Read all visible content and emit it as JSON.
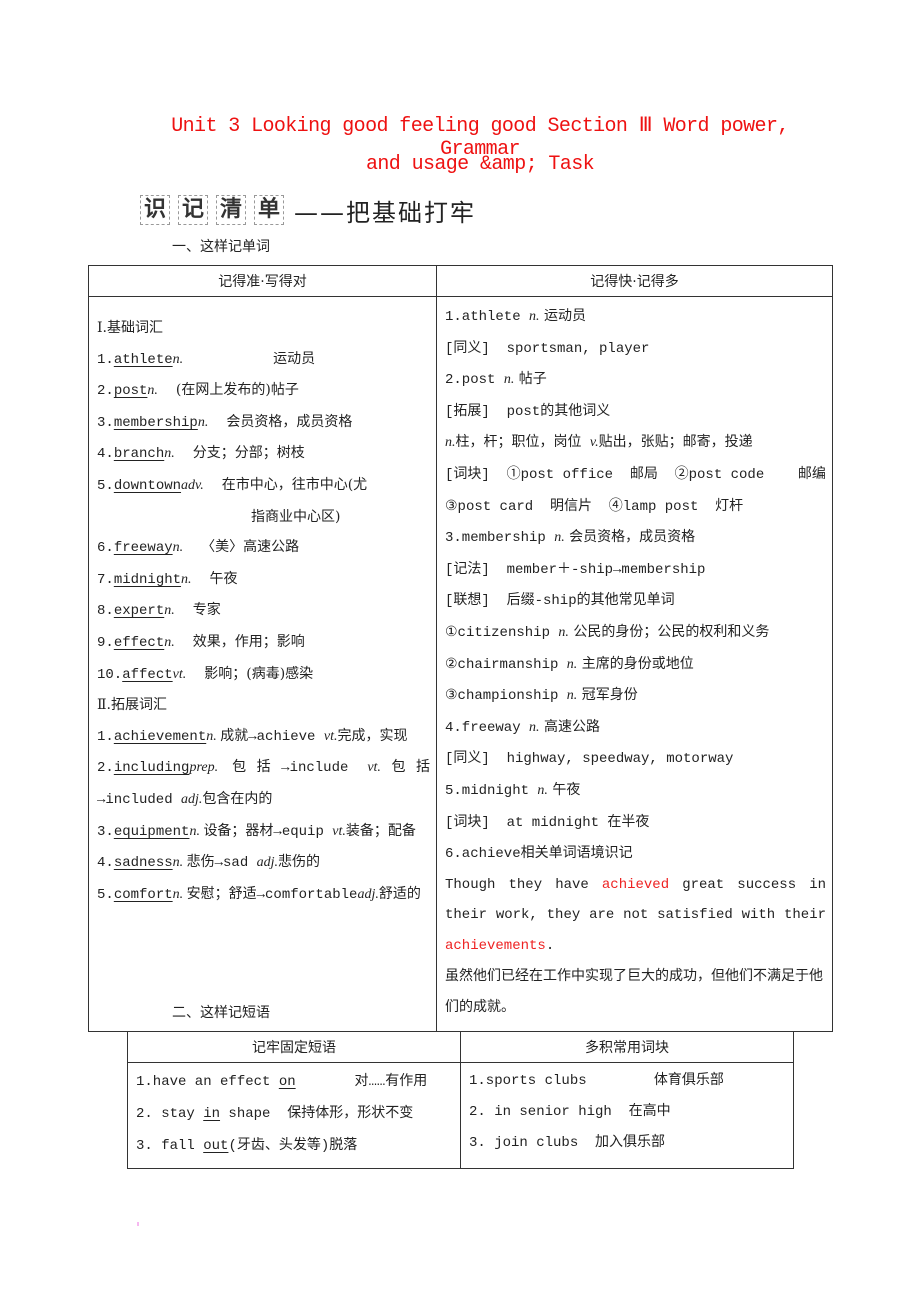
{
  "title": {
    "line1": "Unit 3 Looking good feeling good Section Ⅲ Word power, Grammar",
    "line2": "and usage &amp; Task",
    "color": "#ee1111"
  },
  "banner": {
    "boxed_chars": [
      "识",
      "记",
      "清",
      "单"
    ],
    "rest": "——把基础打牢"
  },
  "section1": {
    "heading": "一、这样记单词",
    "table": {
      "headers": [
        "记得准·写得对",
        "记得快·记得多"
      ],
      "left": {
        "basic_heading": "Ⅰ.基础词汇",
        "basic": [
          {
            "num": "1.",
            "word": "athlete",
            "pos": "n.",
            "meaning": "运动员"
          },
          {
            "num": "2.",
            "word": "post",
            "pos": "n.",
            "meaning": "(在网上发布的)帖子"
          },
          {
            "num": "3.",
            "word": "membership",
            "pos": "n.",
            "meaning": "会员资格，成员资格"
          },
          {
            "num": "4.",
            "word": "branch",
            "pos": "n.",
            "meaning": "分支；分部；树枝"
          },
          {
            "num": "5.",
            "word": "downtown",
            "pos": "adv.",
            "meaning": "在市中心，往市中心(尤",
            "meaning_cont": "指商业中心区)"
          },
          {
            "num": "6.",
            "word": "freeway",
            "pos": "n.",
            "meaning": "〈美〉高速公路"
          },
          {
            "num": "7.",
            "word": "midnight",
            "pos": "n.",
            "meaning": "午夜"
          },
          {
            "num": "8.",
            "word": "expert",
            "pos": "n.",
            "meaning": "专家"
          },
          {
            "num": "9.",
            "word": "effect",
            "pos": "n.",
            "meaning": "效果，作用；影响"
          },
          {
            "num": "10.",
            "word": "affect",
            "pos": "vt.",
            "meaning": "影响；(病毒)感染"
          }
        ],
        "extended_heading": "Ⅱ.拓展词汇",
        "extended": [
          {
            "num": "1.",
            "word": "achievement",
            "pos": "n.",
            "rest": "成就→achieve ",
            "pos2": "vt.",
            "rest2": "完成，实现"
          },
          {
            "num": "2.",
            "word": "including",
            "pos": "prep.",
            "rest": "包括→include ",
            "pos2": "vt.",
            "rest2": "包括→included ",
            "pos3": "adj.",
            "rest3": "包含在内的"
          },
          {
            "num": "3.",
            "word": "equipment",
            "pos": "n.",
            "rest": "设备；器材→equip ",
            "pos2": "vt.",
            "rest2": "装备；配备"
          },
          {
            "num": "4.",
            "word": "sadness",
            "pos": "n.",
            "rest": "悲伤→sad ",
            "pos2": "adj.",
            "rest2": "悲伤的"
          },
          {
            "num": "5.",
            "word": "comfort",
            "pos": "n.",
            "rest": "安慰；舒适→comfortable",
            "pos2": "adj.",
            "rest2": "舒适的"
          }
        ]
      },
      "right": {
        "lines": [
          {
            "a": "1.athlete ",
            "pos": "n.",
            "b": " 运动员"
          },
          {
            "a": "[同义]  sportsman, player"
          },
          {
            "a": "2.post ",
            "pos": "n.",
            "b": " 帖子"
          },
          {
            "a": "[拓展]  post的其他词义"
          },
          {
            "pre_pos": "n.",
            "a": "柱，杆；职位，岗位 ",
            "pos": "v.",
            "b": "贴出，张贴；邮寄，投递"
          },
          {
            "a": "[词块]  ①post office  邮局  ②post code    邮编"
          },
          {
            "a": "③post card  明信片  ④lamp post  灯杆"
          },
          {
            "a": "3.membership ",
            "pos": "n.",
            "b": " 会员资格，成员资格"
          },
          {
            "a": "[记法]  member＋-ship→membership"
          },
          {
            "a": "[联想]  后缀-ship的其他常见单词"
          },
          {
            "a": "①citizenship ",
            "pos": "n.",
            "b": " 公民的身份；公民的权利和义务"
          },
          {
            "a": "②chairmanship ",
            "pos": "n.",
            "b": " 主席的身份或地位"
          },
          {
            "a": "③championship ",
            "pos": "n.",
            "b": " 冠军身份"
          },
          {
            "a": "4.freeway ",
            "pos": "n.",
            "b": " 高速公路"
          },
          {
            "a": "[同义]  highway, speedway, motorway"
          },
          {
            "a": "5.midnight ",
            "pos": "n.",
            "b": " 午夜"
          },
          {
            "a": "[词块]  at midnight 在半夜"
          },
          {
            "a": "6.achieve相关单词语境识记"
          }
        ],
        "example": {
          "p1": "Though they have ",
          "hl1": "achieved",
          "p2": " great success in their work, they are not satisfied with their ",
          "hl2": "achievements",
          "p3": ".",
          "translation": "虽然他们已经在工作中实现了巨大的成功，但他们不满足于他们的成就。",
          "highlight_color": "#ee2222"
        }
      }
    }
  },
  "section2": {
    "heading": "二、这样记短语",
    "table": {
      "headers": [
        "记牢固定短语",
        "多积常用词块"
      ],
      "left": [
        {
          "pre": "1.have an effect ",
          "u": "on",
          "post": "       对……有作用"
        },
        {
          "pre": "2. stay ",
          "u": "in",
          "post": " shape  保持体形，形状不变"
        },
        {
          "pre": "3. fall ",
          "u": "out",
          "post": "(牙齿、头发等)脱落"
        }
      ],
      "right": [
        "1.sports clubs        体育俱乐部",
        "2. in senior high  在高中",
        "3. join clubs  加入俱乐部"
      ]
    }
  }
}
